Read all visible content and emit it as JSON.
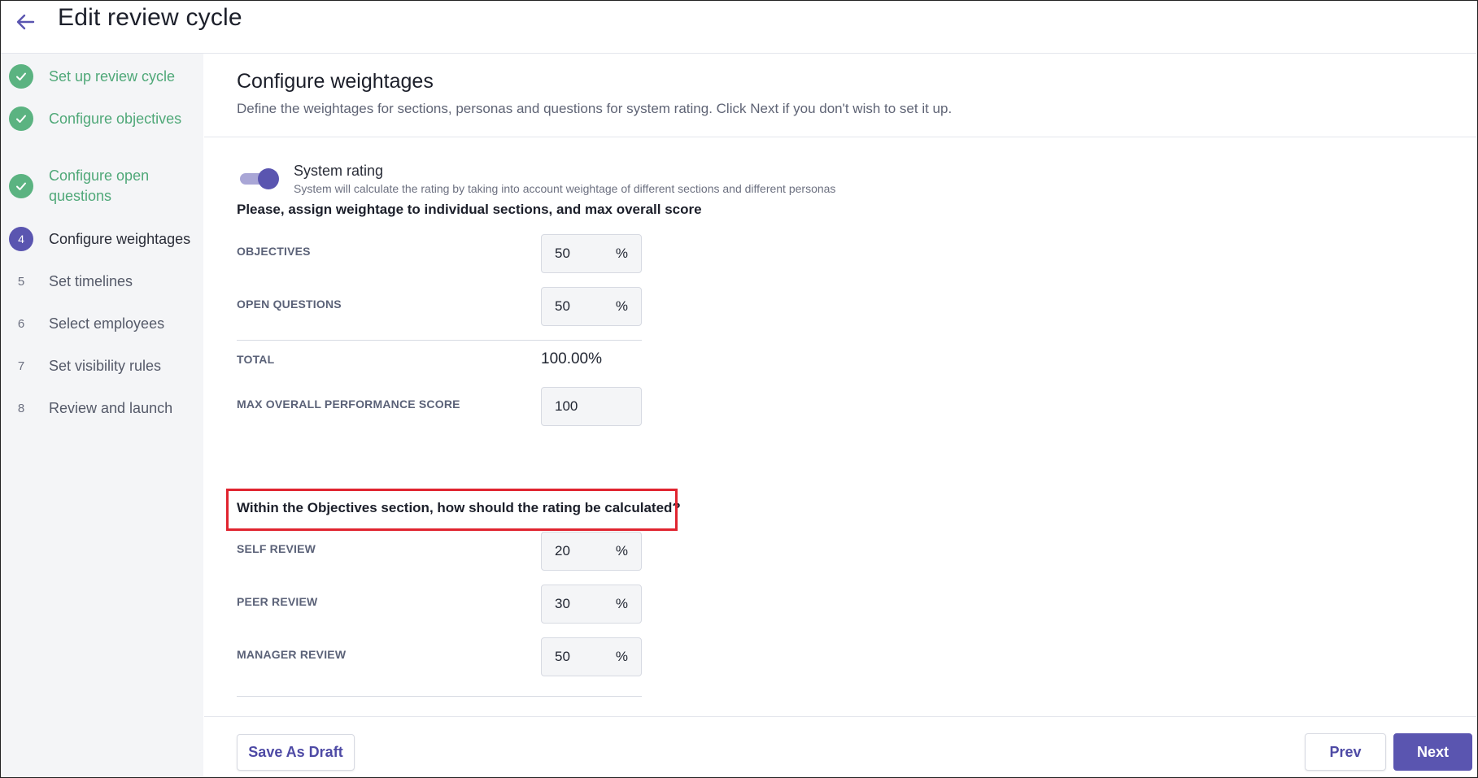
{
  "header": {
    "title": "Edit review cycle",
    "back_icon": "arrow-left-icon"
  },
  "sidebar": {
    "steps": [
      {
        "label": "Set up review cycle",
        "state": "done",
        "marker": ""
      },
      {
        "label": "Configure objectives",
        "state": "done",
        "marker": ""
      },
      {
        "label": "Configure open questions",
        "state": "done",
        "marker": ""
      },
      {
        "label": "Configure weightages",
        "state": "current",
        "marker": "4"
      },
      {
        "label": "Set timelines",
        "state": "todo",
        "marker": "5"
      },
      {
        "label": "Select employees",
        "state": "todo",
        "marker": "6"
      },
      {
        "label": "Set visibility rules",
        "state": "todo",
        "marker": "7"
      },
      {
        "label": "Review and launch",
        "state": "todo",
        "marker": "8"
      }
    ]
  },
  "main": {
    "title": "Configure weightages",
    "description": "Define the weightages for sections, personas and questions for system rating. Click Next if you don't wish to set it up.",
    "system_rating": {
      "enabled": true,
      "label": "System rating",
      "description": "System will calculate the rating by taking into account weightage of different sections and different personas"
    },
    "sections": {
      "heading": "Please, assign weightage to individual sections, and max overall score",
      "rows": [
        {
          "label": "OBJECTIVES",
          "value": "50",
          "unit": "%"
        },
        {
          "label": "OPEN QUESTIONS",
          "value": "50",
          "unit": "%"
        }
      ],
      "total_label": "TOTAL",
      "total_value": "100.00%",
      "max_score_label": "MAX OVERALL PERFORMANCE SCORE",
      "max_score_value": "100"
    },
    "objectives_personas": {
      "heading": "Within the Objectives section, how should the rating be calculated?",
      "rows": [
        {
          "label": "SELF REVIEW",
          "value": "20",
          "unit": "%"
        },
        {
          "label": "PEER REVIEW",
          "value": "30",
          "unit": "%"
        },
        {
          "label": "MANAGER REVIEW",
          "value": "50",
          "unit": "%"
        }
      ]
    }
  },
  "footer": {
    "save_draft_label": "Save As Draft",
    "prev_label": "Prev",
    "next_label": "Next"
  },
  "colors": {
    "accent": "#5a55b0",
    "success": "#5bb381",
    "highlight": "#e0242f"
  }
}
